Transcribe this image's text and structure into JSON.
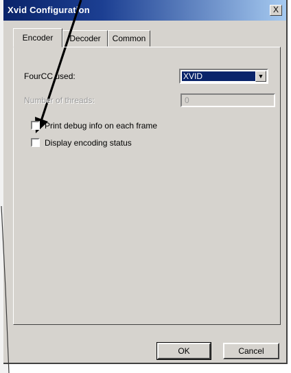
{
  "window": {
    "title": "Xvid Configuration",
    "close_label": "X"
  },
  "tabs": [
    {
      "label": "Encoder",
      "active": true
    },
    {
      "label": "Decoder",
      "active": false
    },
    {
      "label": "Common",
      "active": false
    }
  ],
  "encoder": {
    "fourcc_label": "FourCC used:",
    "fourcc_value": "XVID",
    "threads_label": "Number of threads:",
    "threads_value": "0",
    "threads_enabled": false,
    "debug_checkbox_label": "Print debug info on each frame",
    "debug_checked": false,
    "status_checkbox_label": "Display encoding status",
    "status_checked": false
  },
  "buttons": {
    "ok_label": "OK",
    "cancel_label": "Cancel"
  },
  "colors": {
    "titlebar_start": "#0a246a",
    "titlebar_end": "#a6caf0",
    "dialog_face": "#d6d3ce",
    "selection": "#0a246a",
    "arrow": "#000000"
  },
  "icons": {
    "dropdown": "chevron-down-icon",
    "annotation": "arrow-pointer-icon"
  }
}
